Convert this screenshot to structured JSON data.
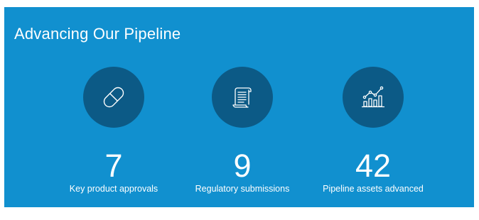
{
  "colors": {
    "panel_background": "#1190cf",
    "icon_circle": "#0c5a86",
    "text": "#ffffff"
  },
  "panel": {
    "title": "Advancing Our Pipeline"
  },
  "stats": [
    {
      "value": "7",
      "label": "Key product approvals",
      "icon": "pill-capsule-icon"
    },
    {
      "value": "9",
      "label": "Regulatory submissions",
      "icon": "document-scroll-icon"
    },
    {
      "value": "42",
      "label": "Pipeline assets advanced",
      "icon": "growth-chart-icon"
    }
  ]
}
